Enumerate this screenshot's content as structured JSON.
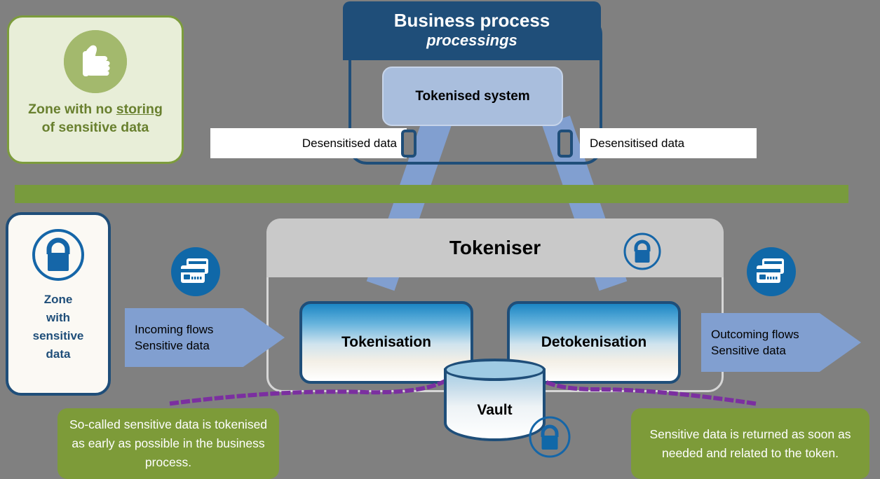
{
  "diagram": {
    "background_color": "#808080",
    "accent_blue": "#1f4e79",
    "accent_green": "#789b3d",
    "accent_light_blue": "#819fd0",
    "accent_purple": "#7b2fa0"
  },
  "zone_no_storing": {
    "icon": "thumbs-up-icon",
    "label_line1_prefix": "Zone with no ",
    "label_line1_underlined": "storing",
    "label_line2": "of sensitive data"
  },
  "business_process": {
    "title": "Business process",
    "subtitle": "processings",
    "tokenised_system_label": "Tokenised system",
    "desensitised_left": "Desensitised data",
    "desensitised_right": "Desensitised data",
    "device_icon": "mobile-phone-icon"
  },
  "zone_sensitive": {
    "icon": "lock-circle-icon",
    "label": "Zone\nwith\nsensitive\ndata",
    "label_line1": "Zone",
    "label_line2": "with",
    "label_line3": "sensitive",
    "label_line4": "data"
  },
  "tokeniser": {
    "title": "Tokeniser",
    "lock_icon": "lock-circle-icon",
    "tokenisation_label": "Tokenisation",
    "detokenisation_label": "Detokenisation",
    "vault_label": "Vault",
    "vault_lock_icon": "lock-circle-icon"
  },
  "flows": {
    "incoming_line1": "Incoming flows",
    "incoming_line2": "Sensitive data",
    "outcoming_line1": "Outcoming flows",
    "outcoming_line2": "Sensitive data",
    "card_icon_left": "credit-card-icon",
    "card_icon_right": "credit-card-icon"
  },
  "callouts": {
    "left": "So-called sensitive data is tokenised as early as possible in the business process.",
    "right": "Sensitive data is returned as soon as needed and related to the token."
  }
}
